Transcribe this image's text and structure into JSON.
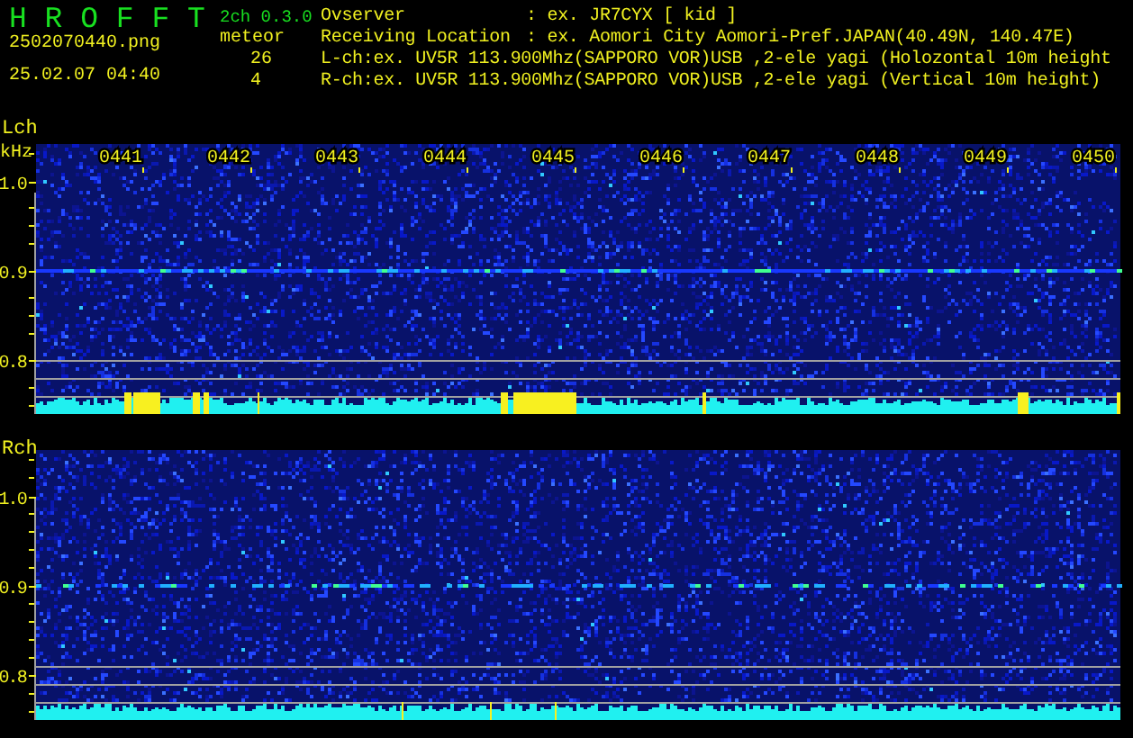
{
  "app": {
    "title": "H R O F F T",
    "version": "2ch 0.3.0"
  },
  "file": {
    "name": "2502070440.png",
    "datetime": "25.02.07 04:40"
  },
  "meteor": {
    "label": "meteor",
    "counts": [
      "26",
      "4"
    ]
  },
  "info": [
    {
      "kind": "field",
      "label": "Ovserver",
      "value": ": ex. JR7CYX [ kid ]"
    },
    {
      "kind": "field",
      "label": "Receiving Location",
      "value": ": ex. Aomori City Aomori-Pref.JAPAN(40.49N, 140.47E)"
    },
    {
      "kind": "line",
      "text": "L-ch:ex. UV5R 113.900Mhz(SAPPORO VOR)USB ,2-ele yagi (Holozontal 10m height"
    },
    {
      "kind": "line",
      "text": "R-ch:ex. UV5R 113.900Mhz(SAPPORO VOR)USB ,2-ele yagi (Vertical 10m height)"
    }
  ],
  "channels": [
    {
      "label": "Lch",
      "unit": "kHz",
      "times": [
        "0441",
        "0442",
        "0443",
        "0444",
        "0445",
        "0446",
        "0447",
        "0448",
        "0449",
        "0450"
      ],
      "frequencies": [
        "1.0",
        "0.9",
        "0.8"
      ]
    },
    {
      "label": "Rch",
      "frequencies": [
        "1.0",
        "0.9",
        "0.8"
      ]
    }
  ]
}
